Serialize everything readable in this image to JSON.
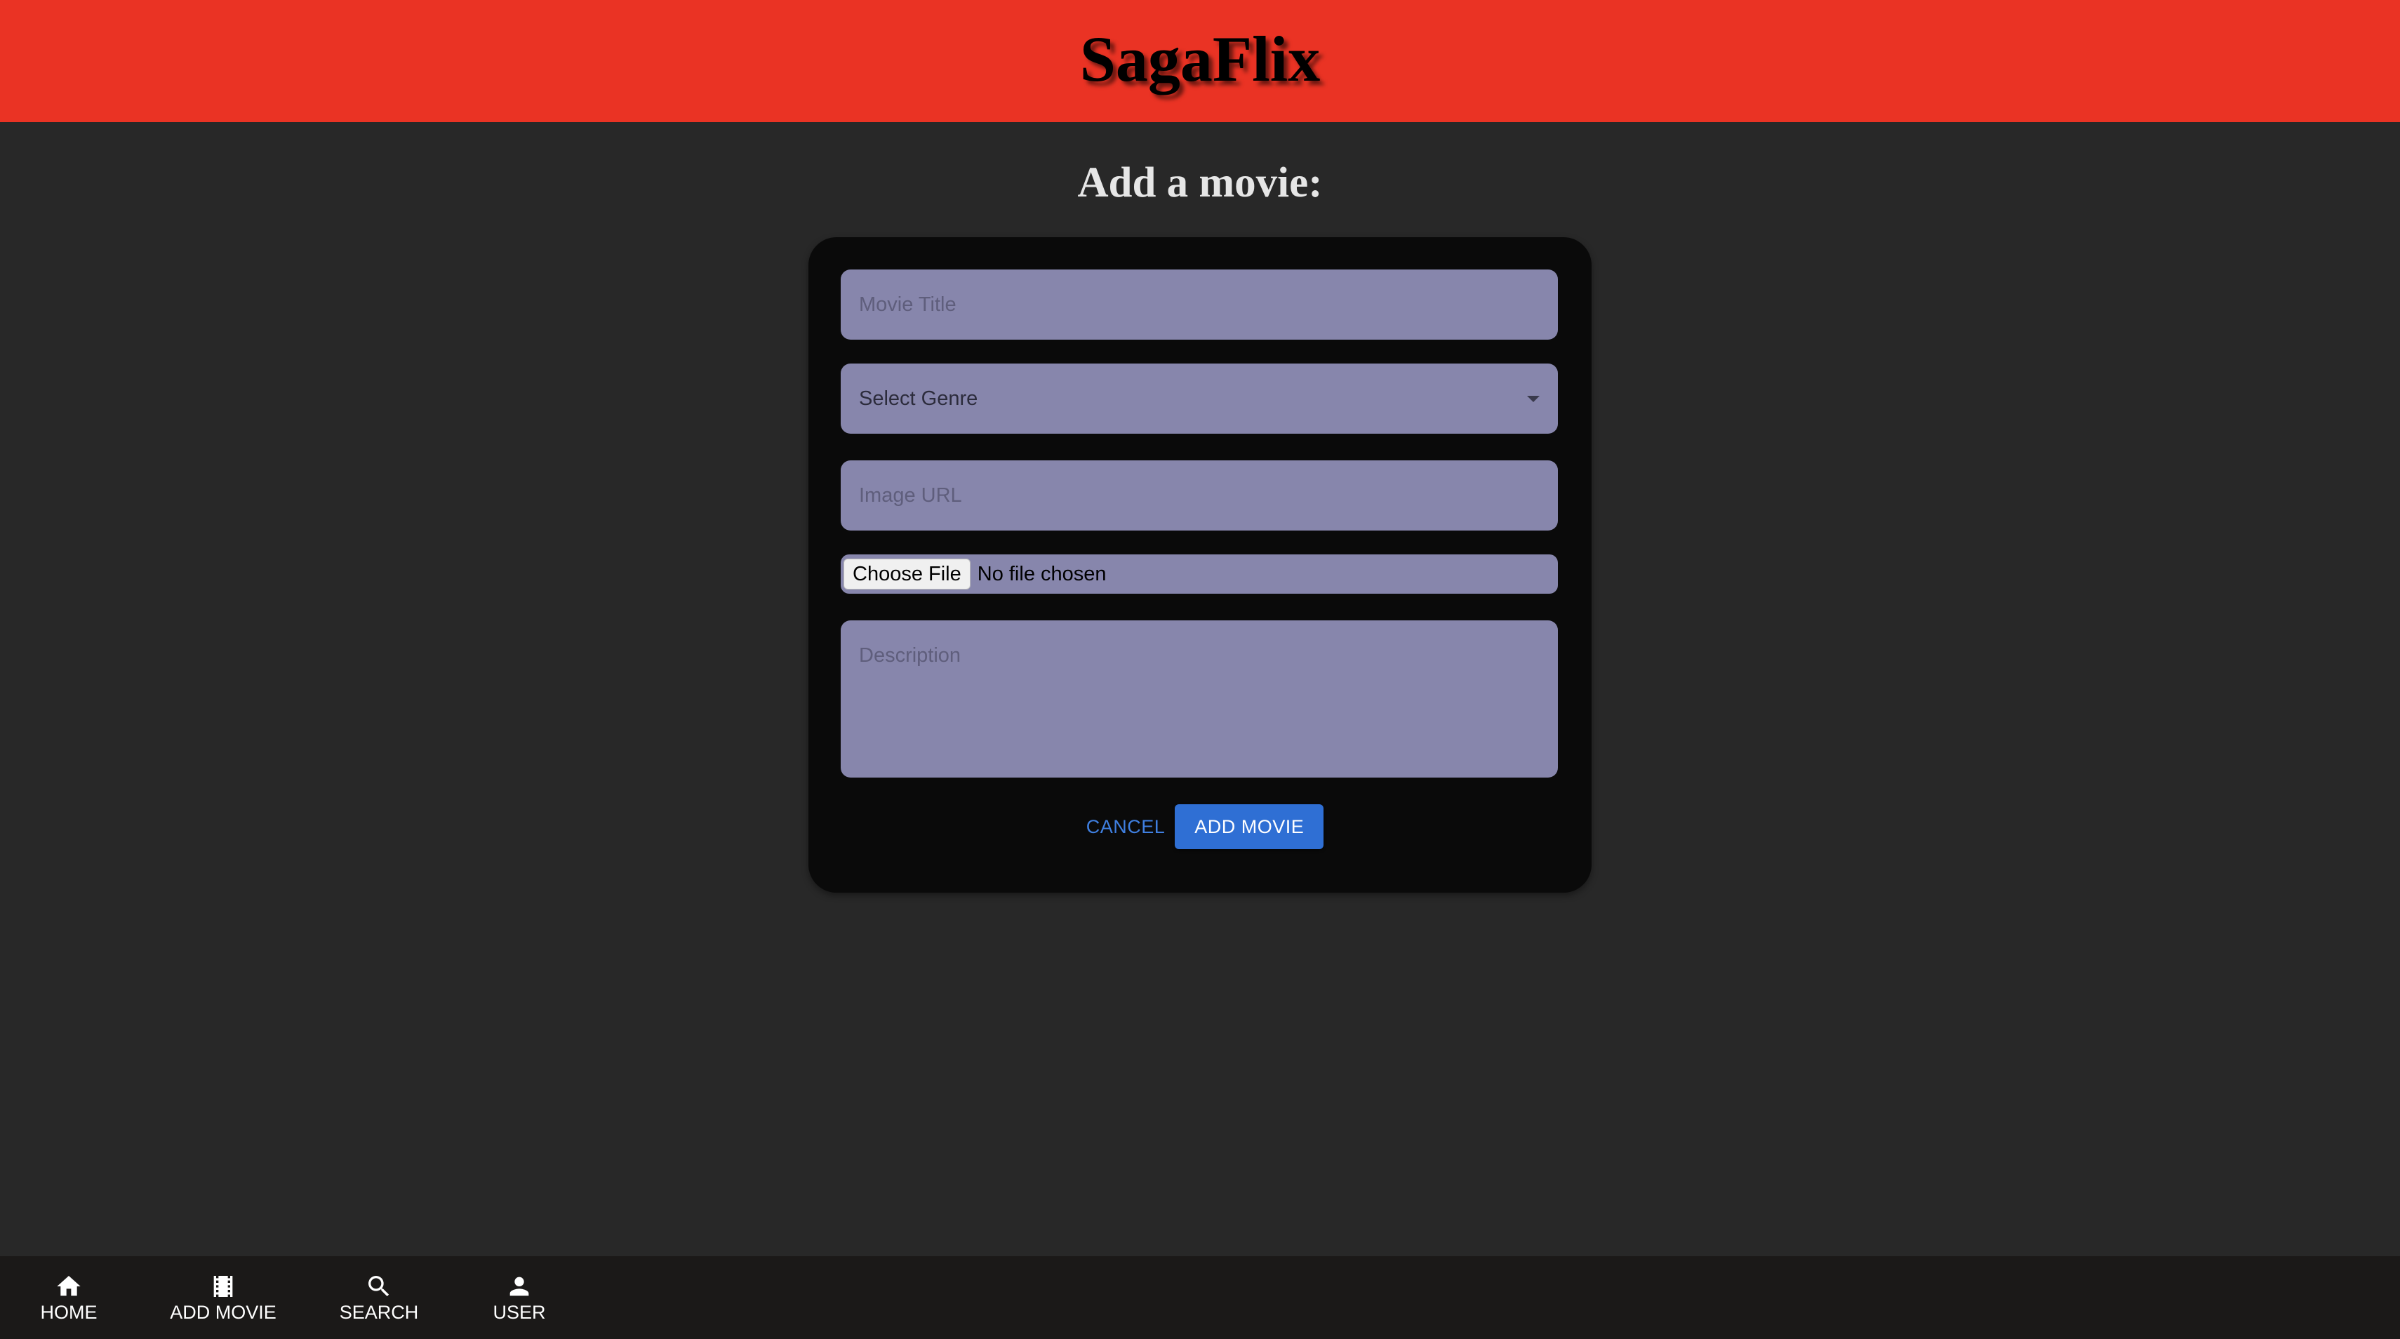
{
  "header": {
    "brand": "SagaFlix"
  },
  "page": {
    "title": "Add a movie:"
  },
  "form": {
    "movie_title_placeholder": "Movie Title",
    "genre_placeholder": "Select Genre",
    "image_url_placeholder": "Image URL",
    "file_button_label": "Choose File",
    "file_status": "No file chosen",
    "description_placeholder": "Description",
    "cancel_label": "CANCEL",
    "submit_label": "ADD MOVIE"
  },
  "nav": {
    "items": [
      {
        "label": "HOME",
        "icon": "home-icon"
      },
      {
        "label": "ADD MOVIE",
        "icon": "movie-icon"
      },
      {
        "label": "SEARCH",
        "icon": "search-icon"
      },
      {
        "label": "USER",
        "icon": "user-icon"
      }
    ]
  },
  "colors": {
    "header": "#ea3324",
    "background": "#282828",
    "card": "#0a0a0a",
    "field": "#8786ac",
    "accent": "#2f6fd4"
  }
}
